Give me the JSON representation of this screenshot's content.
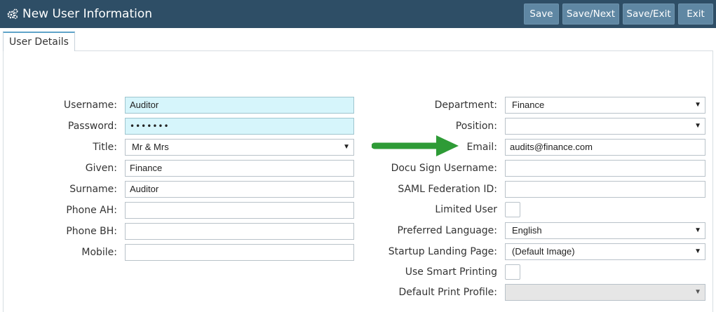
{
  "header": {
    "title": "New User Information",
    "title_icon": "gears-icon",
    "buttons": {
      "save": "Save",
      "save_next": "Save/Next",
      "save_exit": "Save/Exit",
      "exit": "Exit"
    }
  },
  "tabs": [
    {
      "label": "User Details",
      "active": true
    }
  ],
  "form": {
    "left": {
      "username": {
        "label": "Username:",
        "value": "Auditor"
      },
      "password": {
        "label": "Password:",
        "value": "•••••••"
      },
      "title": {
        "label": "Title:",
        "value": "Mr & Mrs"
      },
      "given": {
        "label": "Given:",
        "value": "Finance"
      },
      "surname": {
        "label": "Surname:",
        "value": "Auditor"
      },
      "phone_ah": {
        "label": "Phone AH:",
        "value": ""
      },
      "phone_bh": {
        "label": "Phone BH:",
        "value": ""
      },
      "mobile": {
        "label": "Mobile:",
        "value": ""
      }
    },
    "right": {
      "department": {
        "label": "Department:",
        "value": "Finance"
      },
      "position": {
        "label": "Position:",
        "value": ""
      },
      "email": {
        "label": "Email:",
        "value": "audits@finance.com"
      },
      "docu_sign_username": {
        "label": "Docu Sign Username:",
        "value": ""
      },
      "saml_federation_id": {
        "label": "SAML Federation ID:",
        "value": ""
      },
      "limited_user": {
        "label": "Limited User",
        "checked": false
      },
      "preferred_language": {
        "label": "Preferred Language:",
        "value": "English"
      },
      "startup_landing_page": {
        "label": "Startup Landing Page:",
        "value": "(Default Image)"
      },
      "use_smart_printing": {
        "label": "Use Smart Printing",
        "checked": false
      },
      "default_print_profile": {
        "label": "Default Print Profile:",
        "value": "",
        "disabled": true
      }
    }
  },
  "annotation": {
    "arrow_color": "#2e9b36",
    "points_to": "email"
  },
  "colors": {
    "header_bg": "#2e4e66",
    "button_bg": "#5f87a3",
    "highlight_field": "#d6f5fb",
    "tab_accent": "#5fa3c9"
  }
}
